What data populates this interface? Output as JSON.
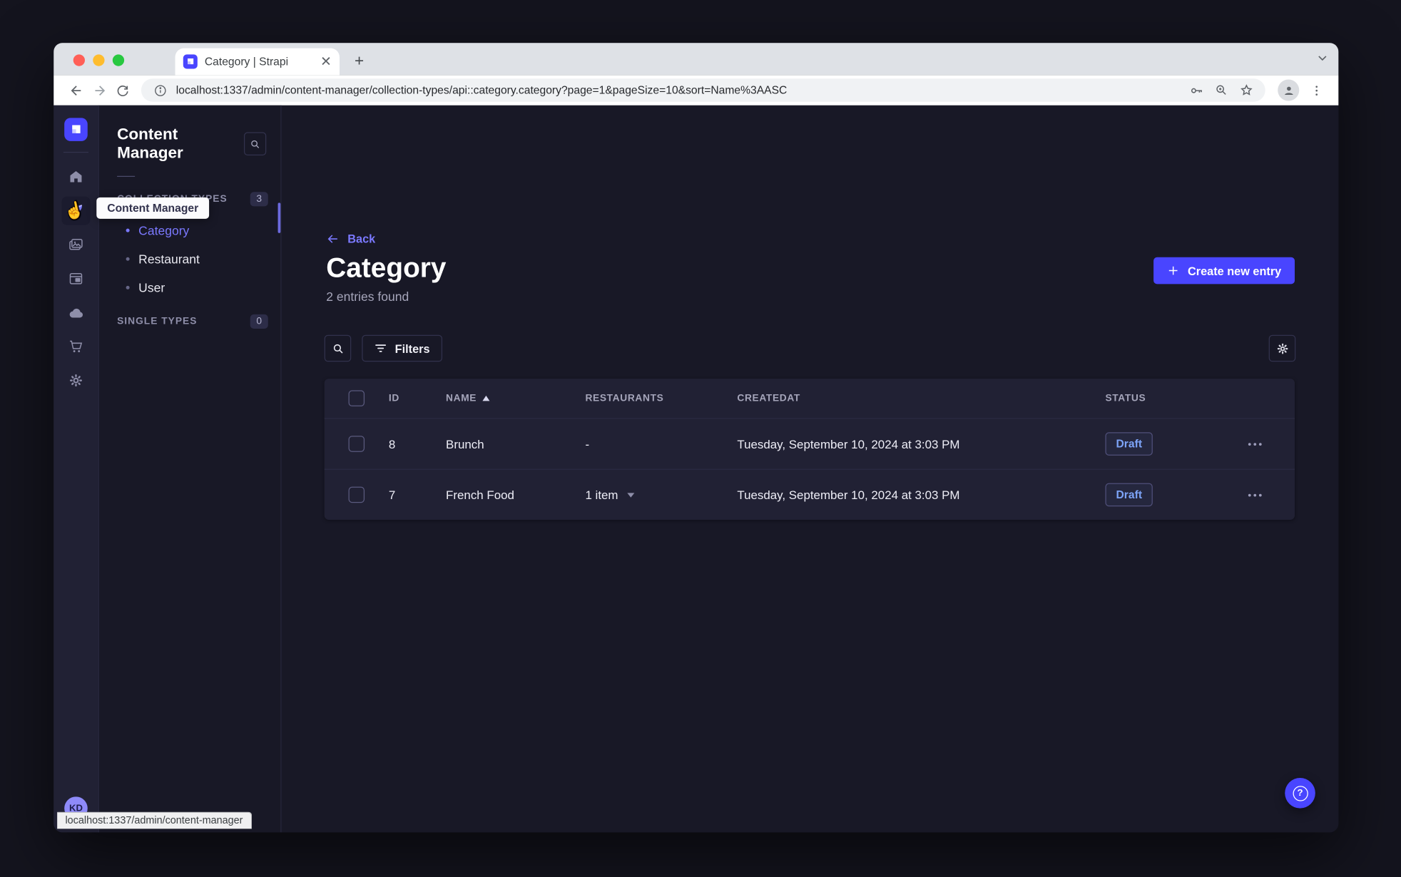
{
  "browser": {
    "tab_title": "Category | Strapi",
    "url": "localhost:1337/admin/content-manager/collection-types/api::category.category?page=1&pageSize=10&sort=Name%3AASC",
    "status_link": "localhost:1337/admin/content-manager"
  },
  "nav": {
    "tooltip": "Content Manager",
    "avatar_initials": "KD"
  },
  "subnav": {
    "title": "Content Manager",
    "collection_types": {
      "label": "COLLECTION TYPES",
      "count": "3",
      "items": [
        "Category",
        "Restaurant",
        "User"
      ]
    },
    "single_types": {
      "label": "SINGLE TYPES",
      "count": "0"
    }
  },
  "main": {
    "back_label": "Back",
    "title": "Category",
    "subtitle": "2 entries found",
    "create_button": "Create new entry",
    "filters_button": "Filters"
  },
  "table": {
    "headers": {
      "id": "ID",
      "name": "NAME",
      "restaurants": "RESTAURANTS",
      "createdat": "CREATEDAT",
      "status": "STATUS"
    },
    "rows": [
      {
        "id": "8",
        "name": "Brunch",
        "restaurants": "-",
        "created": "Tuesday, September 10, 2024 at 3:03 PM",
        "status": "Draft"
      },
      {
        "id": "7",
        "name": "French Food",
        "restaurants": "1 item",
        "created": "Tuesday, September 10, 2024 at 3:03 PM",
        "status": "Draft"
      }
    ]
  },
  "colors": {
    "primary": "#4945ff",
    "link": "#7b79ff",
    "draft_text": "#7da4f8",
    "page_bg": "#181826",
    "card_bg": "#212134"
  }
}
